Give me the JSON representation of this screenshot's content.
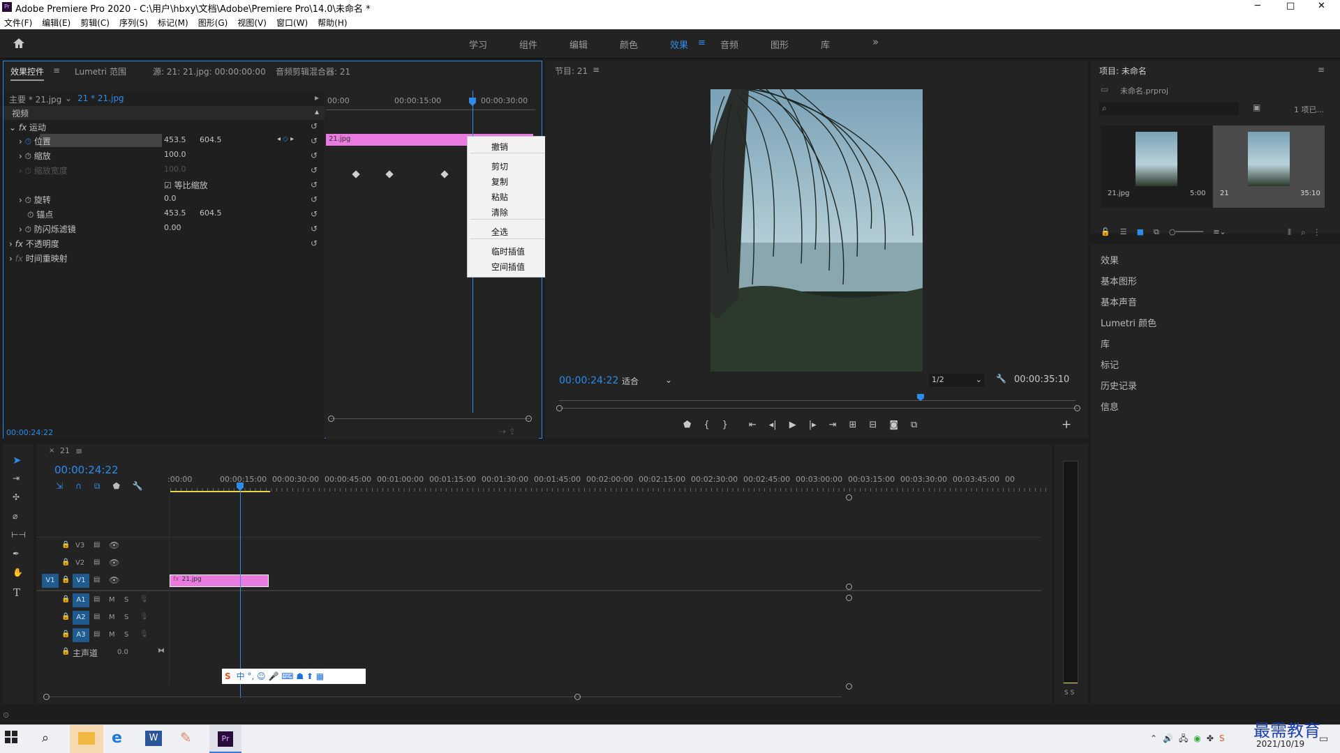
{
  "window": {
    "title": "Adobe Premiere Pro 2020 - C:\\用户\\hbxy\\文档\\Adobe\\Premiere Pro\\14.0\\未命名 *",
    "logo": "Pr",
    "controls": [
      "─",
      "□",
      "✕"
    ]
  },
  "menu": [
    "文件(F)",
    "编辑(E)",
    "剪辑(C)",
    "序列(S)",
    "标记(M)",
    "图形(G)",
    "视图(V)",
    "窗口(W)",
    "帮助(H)"
  ],
  "workspaces": [
    "学习",
    "组件",
    "编辑",
    "颜色",
    "效果",
    "音频",
    "图形",
    "库"
  ],
  "workspaces_active": "效果",
  "workspaces_more": "»",
  "effect_controls": {
    "tabs": [
      "效果控件",
      "Lumetri 范围",
      "源: 21: 21.jpg: 00:00:00:00",
      "音频剪辑混合器: 21"
    ],
    "master": "主要 * 21.jpg",
    "clip": "21 * 21.jpg",
    "section": "视频",
    "ruler": [
      "00:00",
      "00:00:15:00",
      "00:00:30:00"
    ],
    "clip_bar": "21.jpg",
    "fx_group": "运动",
    "props": [
      {
        "name": "位置",
        "v1": "453.5",
        "v2": "604.5"
      },
      {
        "name": "缩放",
        "v1": "100.0",
        "v2": ""
      },
      {
        "name": "缩放宽度",
        "v1": "100.0",
        "v2": ""
      },
      {
        "name": "等比缩放",
        "v1": "",
        "v2": ""
      },
      {
        "name": "旋转",
        "v1": "0.0",
        "v2": ""
      },
      {
        "name": "锚点",
        "v1": "453.5",
        "v2": "604.5"
      },
      {
        "name": "防闪烁滤镜",
        "v1": "0.00",
        "v2": ""
      }
    ],
    "opacity": "不透明度",
    "time_remap": "时间重映射",
    "timecode": "00:00:24:22"
  },
  "context_menu": [
    "撤销",
    "剪切",
    "复制",
    "粘贴",
    "清除",
    "全选",
    "临时插值",
    "空间插值"
  ],
  "program": {
    "title": "节目: 21",
    "timecode": "00:00:24:22",
    "fit": "适合",
    "res": "1/2",
    "duration": "00:00:35:10"
  },
  "project": {
    "title": "项目: 未命名",
    "file": "未命名.prproj",
    "count": "1 项已...",
    "items": [
      {
        "name": "21.jpg",
        "dur": "5:00"
      },
      {
        "name": "21",
        "dur": "35:10"
      }
    ],
    "panels": [
      "效果",
      "基本图形",
      "基本声音",
      "Lumetri 颜色",
      "库",
      "标记",
      "历史记录",
      "信息"
    ]
  },
  "timeline": {
    "seq": "21",
    "timecode": "00:00:24:22",
    "ruler": [
      ":00:00",
      "00:00:15:00",
      "00:00:30:00",
      "00:00:45:00",
      "00:01:00:00",
      "00:01:15:00",
      "00:01:30:00",
      "00:01:45:00",
      "00:02:00:00",
      "00:02:15:00",
      "00:02:30:00",
      "00:02:45:00",
      "00:03:00:00",
      "00:03:15:00",
      "00:03:30:00",
      "00:03:45:00",
      "00"
    ],
    "tracks": [
      "V3",
      "V2",
      "V1",
      "A1",
      "A2",
      "A3"
    ],
    "src_track": "V1",
    "master": "主声道",
    "master_val": "0.0",
    "clip": "21.jpg",
    "m": "M",
    "s": "S"
  },
  "ime": "中",
  "meter_labels": "S S",
  "taskbar": {
    "date": "2021/10/19",
    "watermark": "最需教育"
  }
}
